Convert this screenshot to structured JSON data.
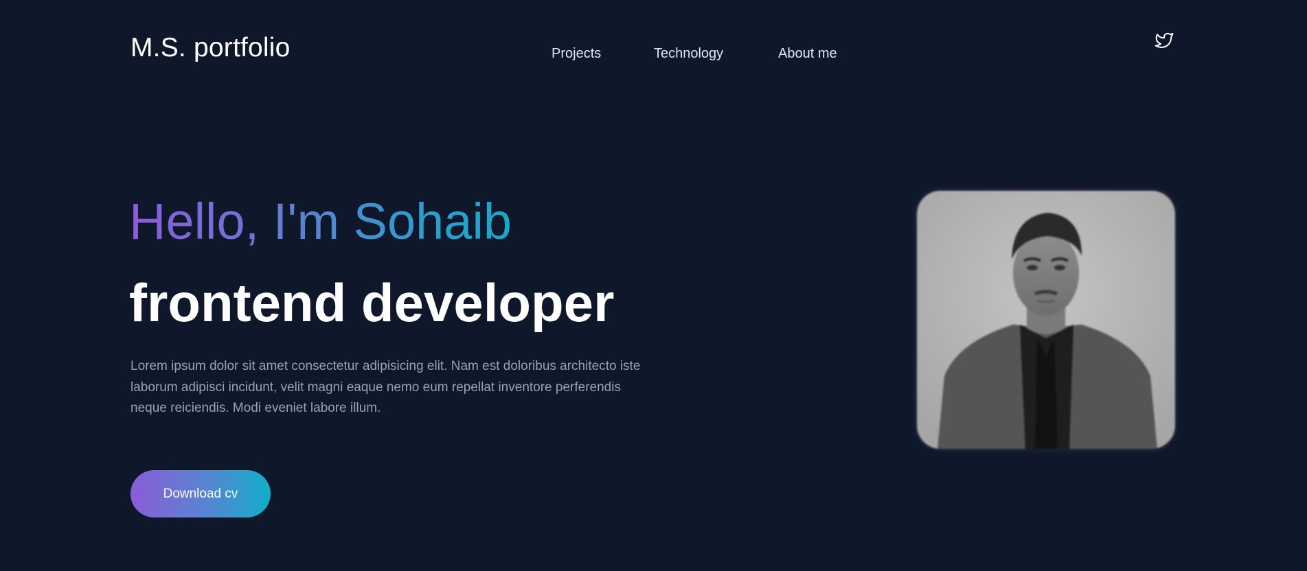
{
  "header": {
    "logo": "M.S. portfolio",
    "nav": [
      {
        "label": "Projects"
      },
      {
        "label": "Technology"
      },
      {
        "label": "About me"
      }
    ],
    "social_icon": "twitter-icon"
  },
  "hero": {
    "greeting": "Hello, I'm Sohaib",
    "role": "frontend developer",
    "bio": "Lorem ipsum dolor sit amet consectetur adipisicing elit. Nam est doloribus architecto iste laborum adipisci incidunt, velit magni eaque nemo eum repellat inventore perferendis neque reiciendis. Modi eveniet labore illum.",
    "cta_label": "Download cv"
  },
  "colors": {
    "background": "#0f172a",
    "gradient_start": "#8b5cd6",
    "gradient_end": "#17aac8",
    "body_text": "#94a3b8"
  }
}
